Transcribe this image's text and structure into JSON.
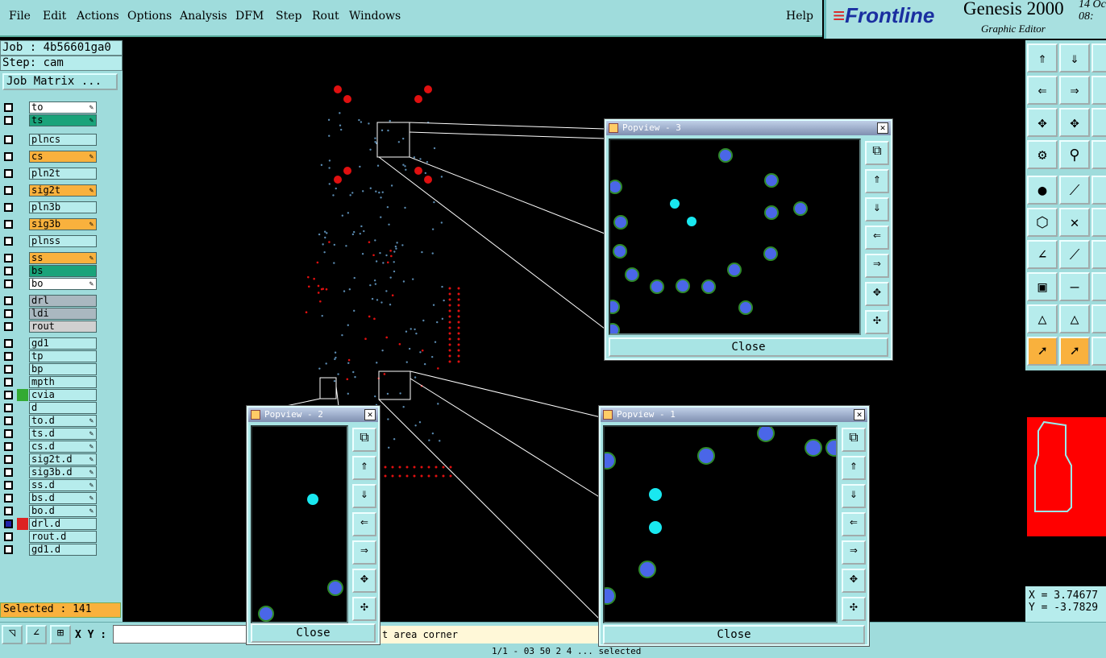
{
  "menu": {
    "items": [
      "File",
      "Edit",
      "Actions",
      "Options",
      "Analysis",
      "DFM",
      "Step",
      "Rout",
      "Windows"
    ],
    "help": "Help"
  },
  "brand": {
    "logo": "Frontline",
    "product": "Genesis 2000",
    "subtitle": "Graphic Editor",
    "date_line1": "14 Oc",
    "date_line2": "08:"
  },
  "job": {
    "job_label": "Job : 4b56601ga0",
    "step_label": "Step: cam",
    "matrix_button": "Job Matrix ..."
  },
  "layers": [
    {
      "name": "to",
      "color": "#ffffff",
      "edit": true
    },
    {
      "name": "ts",
      "color": "#1aa37a",
      "edit": true
    },
    {
      "name": "plncs",
      "color": "#b6ecec",
      "edit": false
    },
    {
      "name": "cs",
      "color": "#f9b13d",
      "edit": true
    },
    {
      "name": "pln2t",
      "color": "#b6ecec",
      "edit": false
    },
    {
      "name": "sig2t",
      "color": "#f9b13d",
      "edit": true
    },
    {
      "name": "pln3b",
      "color": "#b6ecec",
      "edit": false
    },
    {
      "name": "sig3b",
      "color": "#f9b13d",
      "edit": true
    },
    {
      "name": "plnss",
      "color": "#b6ecec",
      "edit": false
    },
    {
      "name": "ss",
      "color": "#f9b13d",
      "edit": true
    },
    {
      "name": "bs",
      "color": "#1aa37a",
      "edit": false
    },
    {
      "name": "bo",
      "color": "#ffffff",
      "edit": true
    },
    {
      "name": "drl",
      "color": "#aab8c0",
      "edit": false
    },
    {
      "name": "ldi",
      "color": "#aab8c0",
      "edit": false
    },
    {
      "name": "rout",
      "color": "#d0d0d0",
      "edit": false
    },
    {
      "name": "gd1",
      "color": "#b6ecec",
      "edit": false
    },
    {
      "name": "tp",
      "color": "#b6ecec",
      "edit": false
    },
    {
      "name": "bp",
      "color": "#b6ecec",
      "edit": false
    },
    {
      "name": "mpth",
      "color": "#b6ecec",
      "edit": false
    },
    {
      "name": "cvia",
      "color": "#b6ecec",
      "edit": false
    },
    {
      "name": "d",
      "color": "#b6ecec",
      "edit": false
    },
    {
      "name": "to.d",
      "color": "#b6ecec",
      "edit": true
    },
    {
      "name": "ts.d",
      "color": "#b6ecec",
      "edit": true
    },
    {
      "name": "cs.d",
      "color": "#b6ecec",
      "edit": true
    },
    {
      "name": "sig2t.d",
      "color": "#b6ecec",
      "edit": true
    },
    {
      "name": "sig3b.d",
      "color": "#b6ecec",
      "edit": true
    },
    {
      "name": "ss.d",
      "color": "#b6ecec",
      "edit": true
    },
    {
      "name": "bs.d",
      "color": "#b6ecec",
      "edit": true
    },
    {
      "name": "bo.d",
      "color": "#b6ecec",
      "edit": true
    },
    {
      "name": "drl.d",
      "color": "#b6ecec",
      "edit": false
    },
    {
      "name": "rout.d",
      "color": "#b6ecec",
      "edit": false
    },
    {
      "name": "gd1.d",
      "color": "#b6ecec",
      "edit": false
    }
  ],
  "selected": "Selected : 141",
  "bottom": {
    "xy_label": "X Y :",
    "xy_value": "",
    "prompt": "t area corner",
    "status": "1/1 - 03 50 2 4 ... selected"
  },
  "coords": {
    "x": "X = 3.74677",
    "y": "Y = -3.7829"
  },
  "popviews": [
    {
      "title": "Popview - 3",
      "close": "Close"
    },
    {
      "title": "Popview - 2",
      "close": "Close"
    },
    {
      "title": "Popview - 1",
      "close": "Close"
    }
  ],
  "colors": {
    "panel": "#9fdcdc",
    "pad_blue": "#4a66e8",
    "pad_ring": "#2f8a2a",
    "pad_cyan": "#19e8f0",
    "red": "#e01010"
  }
}
